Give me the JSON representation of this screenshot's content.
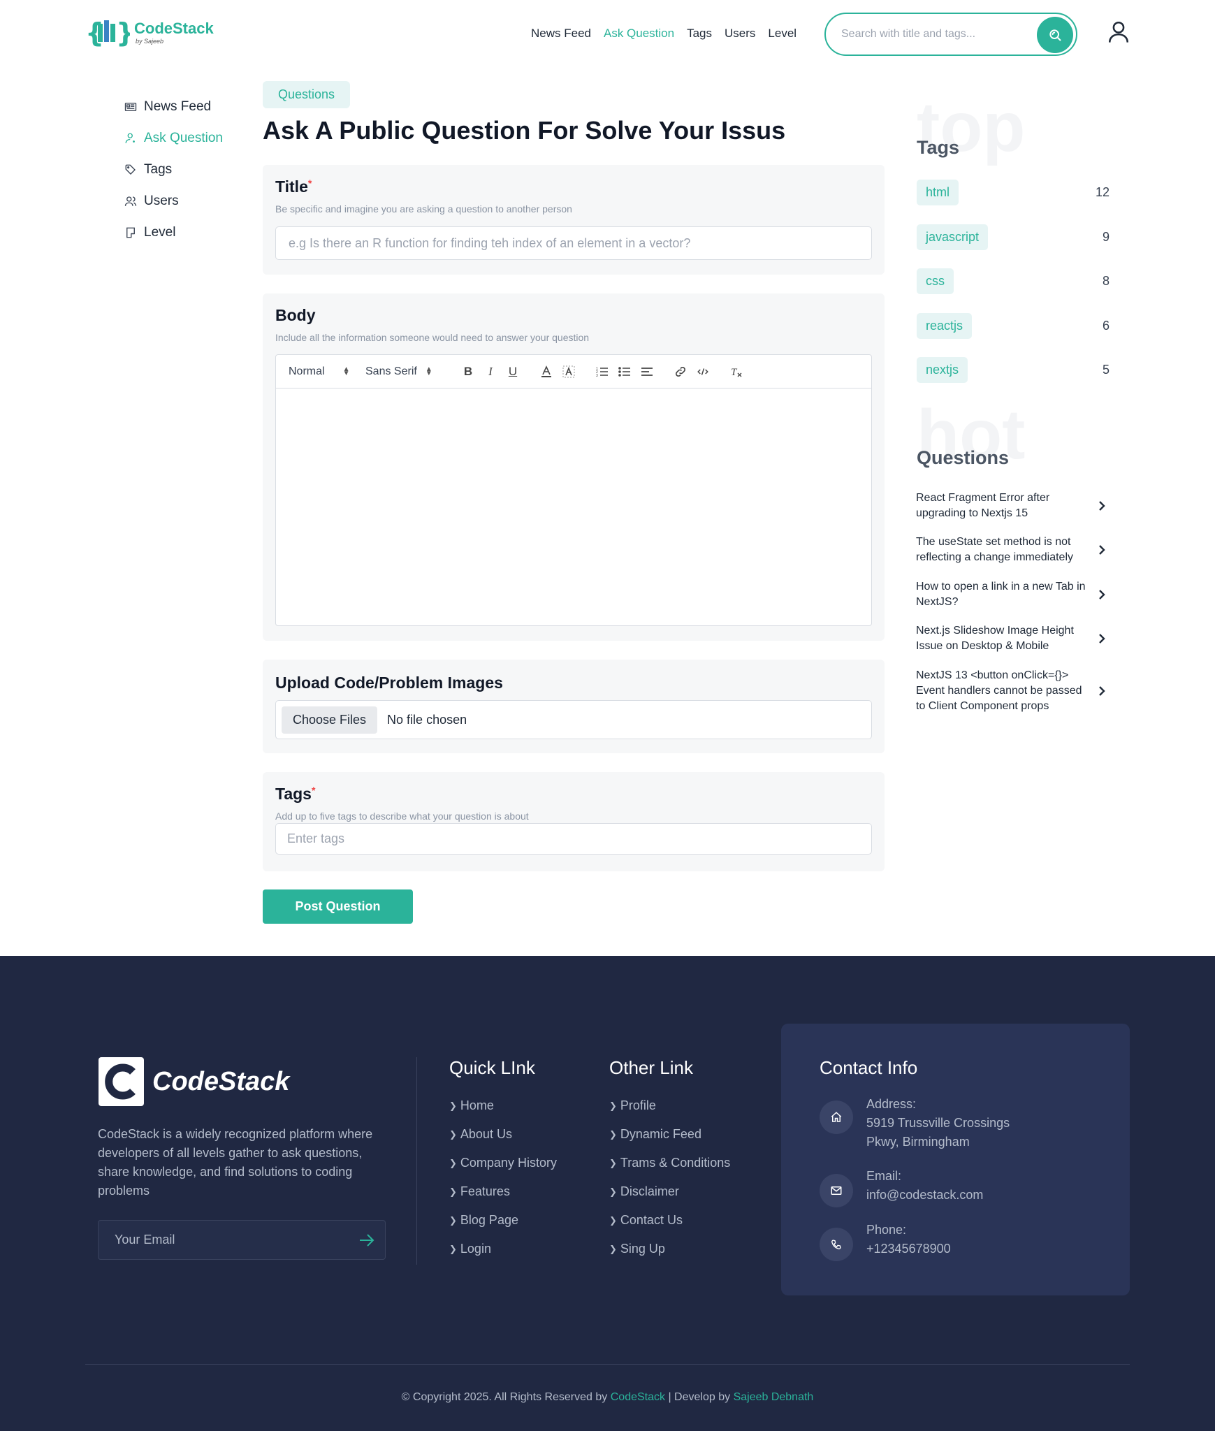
{
  "header": {
    "logo_title": "CodeStack",
    "logo_sub": "by Sajeeb",
    "nav": [
      "News Feed",
      "Ask Question",
      "Tags",
      "Users",
      "Level"
    ],
    "active_nav": "Ask Question",
    "search_placeholder": "Search with title and tags..."
  },
  "sidebar": {
    "items": [
      {
        "label": "News Feed",
        "icon": "newspaper-icon"
      },
      {
        "label": "Ask Question",
        "icon": "user-question-icon"
      },
      {
        "label": "Tags",
        "icon": "tag-icon"
      },
      {
        "label": "Users",
        "icon": "users-icon"
      },
      {
        "label": "Level",
        "icon": "bookmark-icon"
      }
    ],
    "active": "Ask Question"
  },
  "main": {
    "pill": "Questions",
    "heading": "Ask A Public Question For Solve Your Issus",
    "title_section": {
      "label": "Title",
      "required_mark": "*",
      "hint": "Be specific and imagine you are asking a question to another person",
      "placeholder": "e.g Is there an R function for finding teh index of an element in a vector?"
    },
    "body_section": {
      "label": "Body",
      "hint": "Include all the information someone would need to answer your question",
      "format_select": "Normal",
      "font_select": "Sans Serif"
    },
    "upload_section": {
      "label": "Upload Code/Problem Images",
      "button": "Choose Files",
      "status": "No file chosen"
    },
    "tags_section": {
      "label": "Tags",
      "required_mark": "*",
      "hint": "Add up to five tags to describe what your question is about",
      "placeholder": "Enter tags"
    },
    "submit": "Post Question"
  },
  "right": {
    "tags_ghost": "top",
    "tags_title": "Tags",
    "tags": [
      {
        "name": "html",
        "count": "12"
      },
      {
        "name": "javascript",
        "count": "9"
      },
      {
        "name": "css",
        "count": "8"
      },
      {
        "name": "reactjs",
        "count": "6"
      },
      {
        "name": "nextjs",
        "count": "5"
      }
    ],
    "questions_ghost": "hot",
    "questions_title": "Questions",
    "questions": [
      "React Fragment Error after upgrading to Nextjs 15",
      "The useState set method is not reflecting a change immediately",
      "How to open a link in a new Tab in NextJS?",
      "Next.js Slideshow Image Height Issue on Desktop & Mobile",
      "NextJS 13 <button onClick={}> Event handlers cannot be passed to Client Component props"
    ]
  },
  "footer": {
    "logo_text": "CodeStack",
    "description": "CodeStack is a widely recognized platform where developers of all levels gather to ask questions, share knowledge, and find solutions to coding problems",
    "email_placeholder": "Your Email",
    "quick_title": "Quick LInk",
    "quick_links": [
      "Home",
      "About Us",
      "Company History",
      "Features",
      "Blog Page",
      "Login"
    ],
    "other_title": "Other Link",
    "other_links": [
      "Profile",
      "Dynamic Feed",
      "Trams & Conditions",
      "Disclaimer",
      "Contact Us",
      "Sing Up"
    ],
    "contact_title": "Contact Info",
    "address_label": "Address:",
    "address_line1": "5919 Trussville Crossings",
    "address_line2": "Pkwy, Birmingham",
    "email_label": "Email:",
    "email_value": "info@codestack.com",
    "phone_label": "Phone:",
    "phone_value": "+12345678900",
    "copyright_prefix": "© Copyright 2025. All Rights Reserved by",
    "copyright_brand": "CodeStack",
    "copyright_mid": "| Develop by",
    "copyright_author": "Sajeeb Debnath"
  },
  "colors": {
    "accent": "#2bb39a",
    "footer_bg": "#202842",
    "contact_card_bg": "#2a3457"
  }
}
